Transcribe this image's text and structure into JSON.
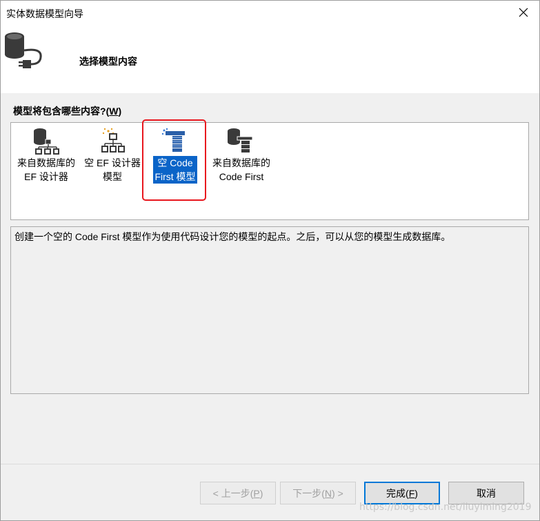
{
  "window": {
    "title": "实体数据模型向导"
  },
  "header": {
    "title": "选择模型内容"
  },
  "question": {
    "label": "模型将包含哪些内容?",
    "accel_open": "(",
    "accel_key": "W",
    "accel_close": ")"
  },
  "options": [
    {
      "line1": "来自数据库的",
      "line2": "EF 设计器",
      "icon": "database-org-chart-icon",
      "selected": false
    },
    {
      "line1": "空 EF 设计器",
      "line2": "模型",
      "icon": "empty-org-chart-icon",
      "selected": false
    },
    {
      "line1": "空 Code",
      "line2": "First 模型",
      "icon": "code-first-empty-icon",
      "selected": true
    },
    {
      "line1": "来自数据库的",
      "line2": "Code First",
      "icon": "database-code-first-icon",
      "selected": false
    }
  ],
  "description": "创建一个空的 Code First 模型作为使用代码设计您的模型的起点。之后，可以从您的模型生成数据库。",
  "buttons": {
    "prev": {
      "label": "< 上一步(",
      "key": "P",
      "tail": ")"
    },
    "next": {
      "label": "下一步(",
      "key": "N",
      "tail": ") >"
    },
    "finish": {
      "label": "完成(",
      "key": "F",
      "tail": ")"
    },
    "cancel": {
      "label": "取消"
    }
  },
  "watermark": "https://blog.csdn.net/liuyiming2019",
  "colors": {
    "selection": "#0a64c8",
    "highlight_frame": "#e8161d",
    "dialog_bg": "#f0f0f0"
  }
}
